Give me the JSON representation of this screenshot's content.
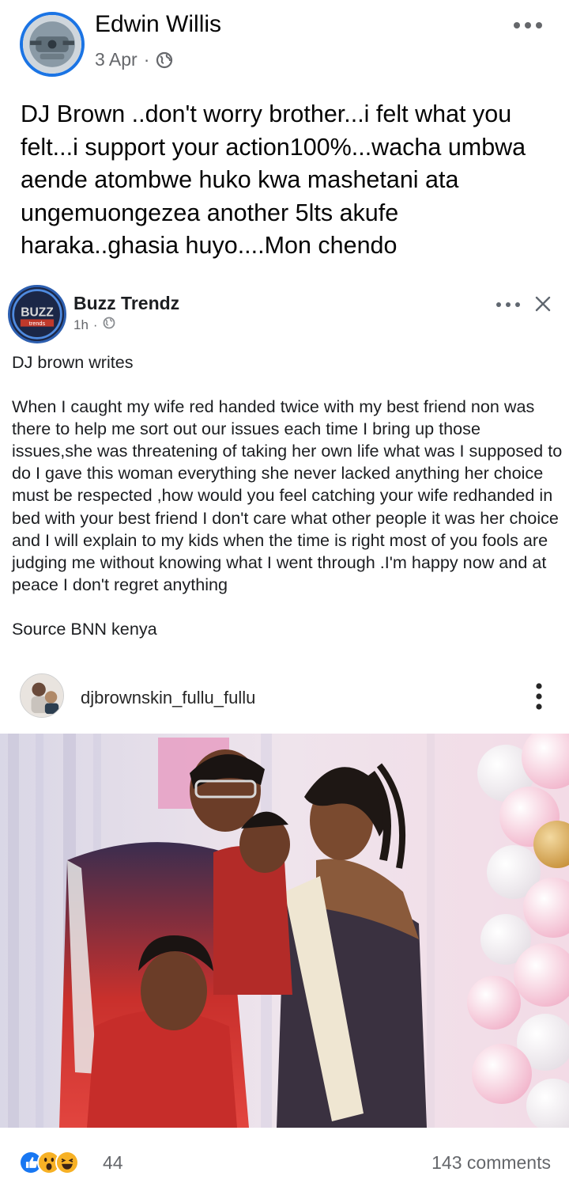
{
  "post": {
    "author": "Edwin Willis",
    "date": "3 Apr",
    "separator": "·",
    "text": "DJ Brown ..don't worry brother...i felt what you felt...i support your action100%...wacha umbwa aende atombwe huko kwa mashetani ata ungemuongezea another 5lts akufe haraka..ghasia huyo....Mon chendo"
  },
  "shared_post": {
    "page_name": "Buzz Trendz",
    "avatar_text": "BUZZ",
    "avatar_subtext": "trends",
    "time": "1h",
    "separator": "·",
    "paragraph_1": "DJ brown writes",
    "paragraph_2": "When I caught my wife red handed twice with my best friend non was there to help me sort out our issues each time I bring up those issues,she was threatening of taking her own life what was I supposed to do I gave this woman everything she never lacked anything  her choice must be respected  ,how would you feel catching your wife redhanded in bed with your best friend  I don't care what other people it was her choice and I will explain to my kids when the time is right most of you fools are judging me without knowing what I went through .I'm happy now and at peace I don't regret anything",
    "paragraph_3": "Source BNN kenya",
    "instagram": {
      "username": "djbrownskin_fullu_fullu"
    }
  },
  "footer": {
    "reaction_count": "44",
    "comment_count": "143 comments",
    "reactions": [
      "like",
      "wow",
      "haha"
    ]
  },
  "colors": {
    "accent": "#1b74e4",
    "secondary_text": "#65676b",
    "like_blue": "#1877f2",
    "emoji_yellow": "#f7b125"
  }
}
